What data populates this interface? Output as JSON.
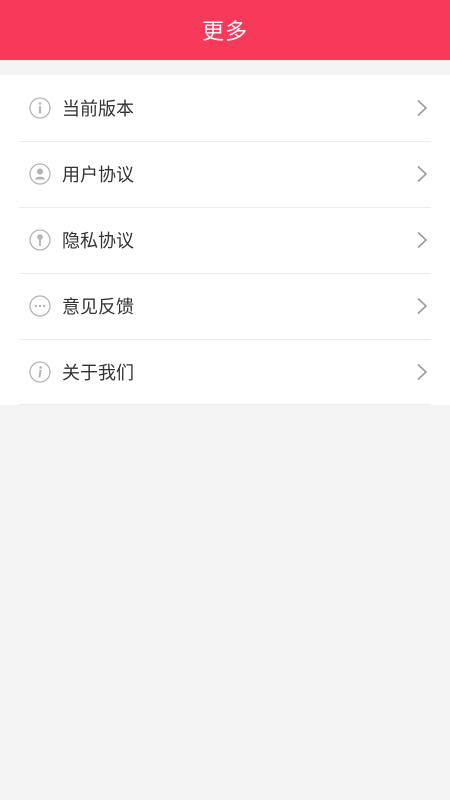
{
  "header": {
    "title": "更多",
    "color": "#f7395a"
  },
  "menu": {
    "items": [
      {
        "label": "当前版本",
        "icon": "info-icon"
      },
      {
        "label": "用户协议",
        "icon": "user-icon"
      },
      {
        "label": "隐私协议",
        "icon": "key-icon"
      },
      {
        "label": "意见反馈",
        "icon": "more-dots-icon"
      },
      {
        "label": "关于我们",
        "icon": "info-icon"
      }
    ]
  }
}
